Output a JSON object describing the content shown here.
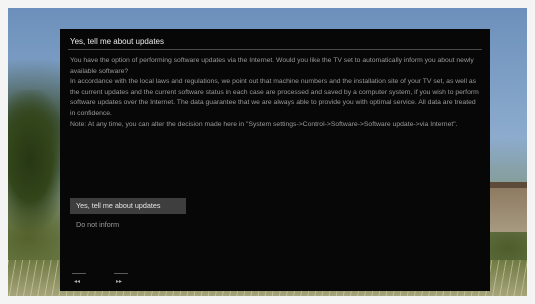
{
  "dialog": {
    "title": "Yes, tell me about updates",
    "paragraphs": [
      "You have the option of performing software updates via the Internet. Would you like the TV set to automatically inform you about newly available software?",
      "In accordance with the local laws and regulations, we point out that machine numbers and the installation site of your TV set, as well as the current updates and the current software status in each case are processed and saved by a computer system, if you wish to perform software updates over the Internet. The data guarantee that we are always able to provide you with optimal service. All data are treated in confidence.",
      "Note: At any time, you can alter the decision made here in \"System settings->Control->Software->Software update->via Internet\"."
    ],
    "options": [
      {
        "label": "Yes, tell me about updates",
        "selected": true
      },
      {
        "label": "Do not inform",
        "selected": false
      }
    ]
  },
  "nav": {
    "prev_icon": "rewind-icon",
    "prev_glyph": "◂◂",
    "next_icon": "fast-forward-icon",
    "next_glyph": "▸▸"
  }
}
